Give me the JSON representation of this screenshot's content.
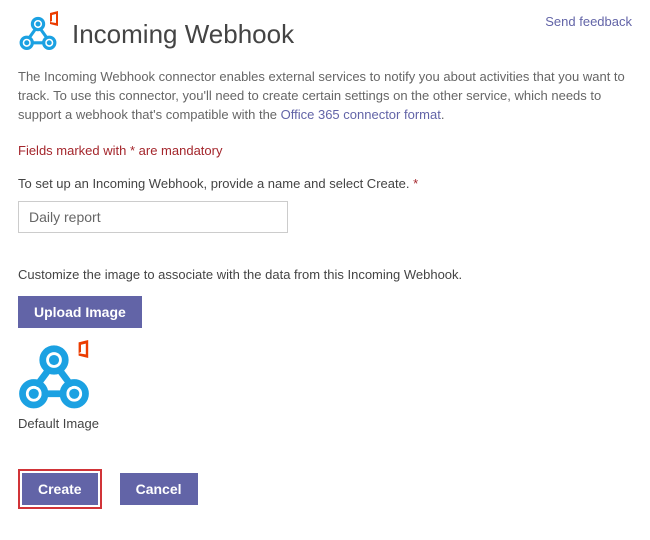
{
  "header": {
    "title": "Incoming Webhook",
    "feedback": "Send feedback"
  },
  "description": {
    "part1": "The Incoming Webhook connector enables external services to notify you about activities that you want to track. To use this connector, you'll need to create certain settings on the other service, which needs to support a webhook that's compatible with the ",
    "link": "Office 365 connector format",
    "part2": "."
  },
  "mandatory": "Fields marked with * are mandatory",
  "setup": {
    "label": "To set up an Incoming Webhook, provide a name and select Create.",
    "asterisk": "*",
    "value": "Daily report"
  },
  "customize": {
    "label": "Customize the image to associate with the data from this Incoming Webhook.",
    "upload": "Upload Image",
    "default_label": "Default Image"
  },
  "footer": {
    "create": "Create",
    "cancel": "Cancel"
  }
}
